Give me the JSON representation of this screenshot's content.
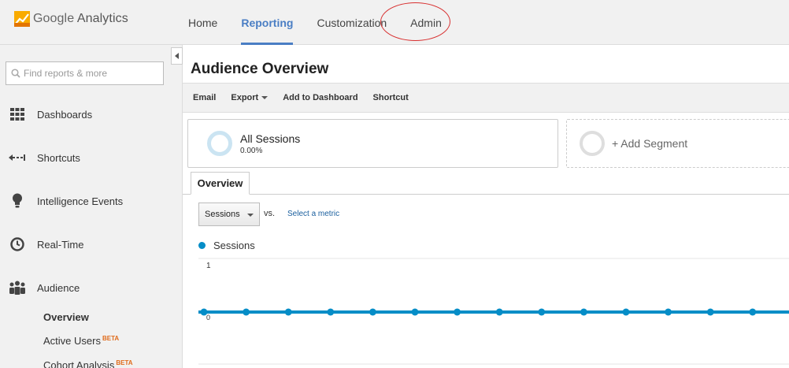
{
  "brand": {
    "name_google": "Google",
    "name_product": "Analytics",
    "colors": [
      "#f9ab00",
      "#e37400"
    ]
  },
  "nav": {
    "items": [
      {
        "label": "Home",
        "active": false
      },
      {
        "label": "Reporting",
        "active": true
      },
      {
        "label": "Customization",
        "active": false
      },
      {
        "label": "Admin",
        "active": false
      }
    ],
    "active_color": "#4a7ec4",
    "highlight_color": "#d83030"
  },
  "sidebar": {
    "search_placeholder": "Find reports & more",
    "items": [
      {
        "label": "Dashboards",
        "icon": "grid-icon"
      },
      {
        "label": "Shortcuts",
        "icon": "shortcut-arrow-icon"
      },
      {
        "label": "Intelligence Events",
        "icon": "lightbulb-icon"
      },
      {
        "label": "Real-Time",
        "icon": "clock-icon"
      },
      {
        "label": "Audience",
        "icon": "people-icon"
      }
    ],
    "sub_items": [
      {
        "label": "Overview",
        "active": true,
        "beta": ""
      },
      {
        "label": "Active Users",
        "active": false,
        "beta": "BETA"
      },
      {
        "label": "Cohort Analysis",
        "active": false,
        "beta": "BETA"
      }
    ]
  },
  "main": {
    "title": "Audience Overview",
    "toolbar": {
      "email": "Email",
      "export": "Export",
      "add_dashboard": "Add to Dashboard",
      "shortcut": "Shortcut"
    },
    "segments": {
      "all_name": "All Sessions",
      "all_pct": "0.00%",
      "add_label": "+ Add Segment"
    },
    "tab": "Overview",
    "metric": {
      "selected": "Sessions",
      "vs": "vs.",
      "select_link": "Select a metric"
    },
    "legend": "Sessions"
  },
  "chart_data": {
    "type": "line",
    "series": [
      {
        "name": "Sessions",
        "values": [
          0,
          0,
          0,
          0,
          0,
          0,
          0,
          0,
          0,
          0,
          0,
          0,
          0,
          0
        ]
      }
    ],
    "ylim": [
      0,
      1
    ],
    "yticks": [
      "1",
      "0"
    ],
    "grid": true,
    "line_color": "#058dc7"
  }
}
